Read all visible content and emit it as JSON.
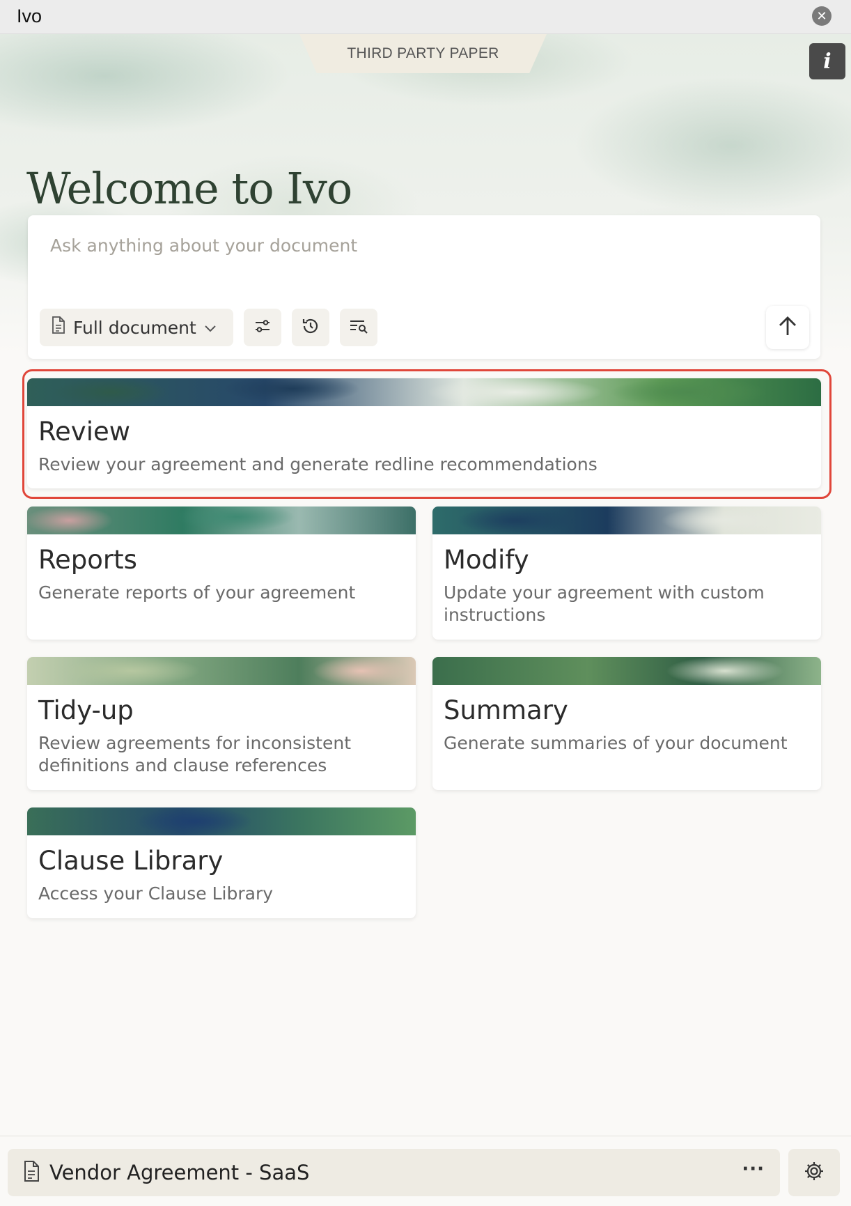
{
  "window": {
    "title": "Ivo",
    "close_icon": "close-icon"
  },
  "header": {
    "tab_label": "THIRD PARTY PAPER",
    "info_label": "i"
  },
  "welcome": {
    "heading": "Welcome to Ivo"
  },
  "ask": {
    "placeholder": "Ask anything about your document",
    "scope_label": "Full document",
    "tools": [
      "sliders-icon",
      "history-icon",
      "search-list-icon"
    ],
    "send_icon": "arrow-up-icon"
  },
  "workflows": [
    {
      "title": "Review",
      "description": "Review your agreement and generate redline recommendations",
      "highlighted": true
    },
    {
      "title": "Reports",
      "description": "Generate reports of your agreement"
    },
    {
      "title": "Modify",
      "description": "Update your agreement with custom instructions"
    },
    {
      "title": "Tidy-up",
      "description": "Review agreements for inconsistent definitions and clause references"
    },
    {
      "title": "Summary",
      "description": "Generate summaries of your document"
    },
    {
      "title": "Clause Library",
      "description": "Access your Clause Library"
    }
  ],
  "footer": {
    "document_name": "Vendor Agreement - SaaS",
    "more_label": "···",
    "settings_icon": "gear-icon"
  },
  "colors": {
    "accent_green": "#2f4232",
    "highlight_red": "#e0463a"
  }
}
